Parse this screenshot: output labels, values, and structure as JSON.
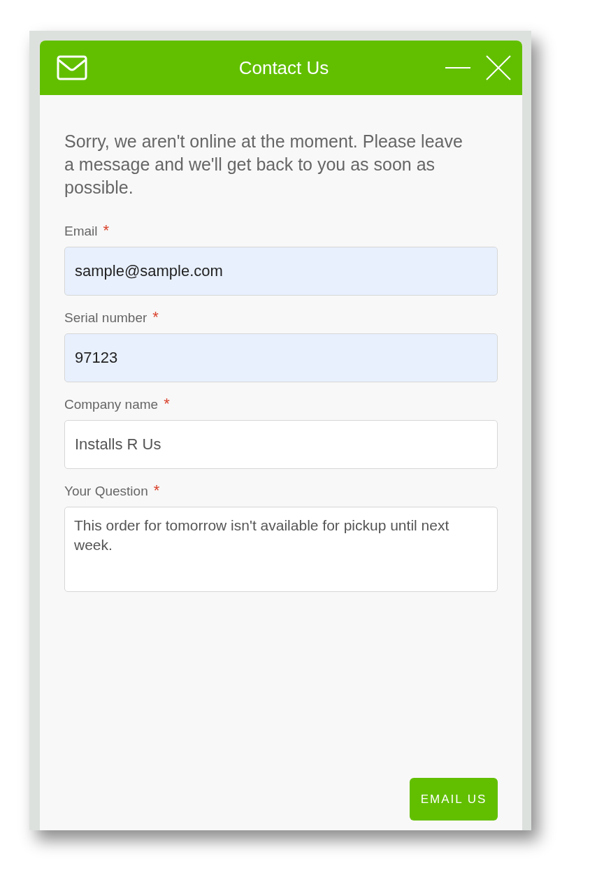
{
  "window": {
    "title": "Contact Us"
  },
  "message": "Sorry, we aren't online at the moment. Please leave a message and we'll get back to you as soon as possible.",
  "fields": [
    {
      "kind": "input",
      "label": "Email",
      "required_mark": "*",
      "value": "sample@sample.com",
      "autofilled": true
    },
    {
      "kind": "input",
      "label": "Serial number",
      "required_mark": "*",
      "value": "97123",
      "autofilled": true
    },
    {
      "kind": "input",
      "label": "Company name",
      "required_mark": "*",
      "value": "Installs R Us",
      "autofilled": false
    },
    {
      "kind": "textarea",
      "label": "Your Question",
      "required_mark": "*",
      "value": "This order for tomorrow isn't available for pickup until next week.",
      "autofilled": false
    }
  ],
  "submit_button": "EMAIL US"
}
